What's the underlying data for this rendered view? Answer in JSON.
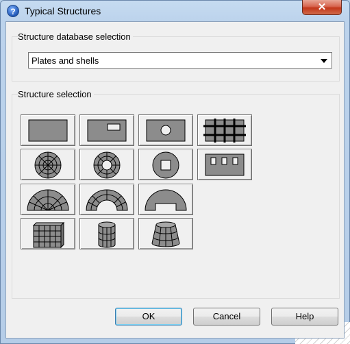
{
  "window": {
    "title": "Typical Structures",
    "close_glyph": "✕",
    "icon_glyph": "?",
    "icon_name": "help-question-icon"
  },
  "database_group": {
    "label": "Structure database selection",
    "selected": "Plates and shells"
  },
  "structure_group": {
    "label": "Structure selection",
    "items": [
      {
        "name": "plate-rectangular-icon"
      },
      {
        "name": "plate-rectangular-hole-icon"
      },
      {
        "name": "plate-circular-hole-icon"
      },
      {
        "name": "plate-stiffened-grid-icon"
      },
      {
        "name": "disc-meshed-icon"
      },
      {
        "name": "ring-meshed-icon"
      },
      {
        "name": "disc-square-hole-icon"
      },
      {
        "name": "plate-multiple-holes-icon"
      },
      {
        "name": "half-disc-meshed-icon"
      },
      {
        "name": "half-ring-meshed-icon"
      },
      {
        "name": "half-ring-icon"
      },
      {
        "name": "box-meshed-icon"
      },
      {
        "name": "cylinder-meshed-icon"
      },
      {
        "name": "cone-meshed-icon"
      }
    ]
  },
  "buttons": {
    "ok": "OK",
    "cancel": "Cancel",
    "help": "Help"
  },
  "colors": {
    "shape_fill": "#8c8c8c",
    "titlebar": "#c6dbf1",
    "close": "#c2361a"
  }
}
